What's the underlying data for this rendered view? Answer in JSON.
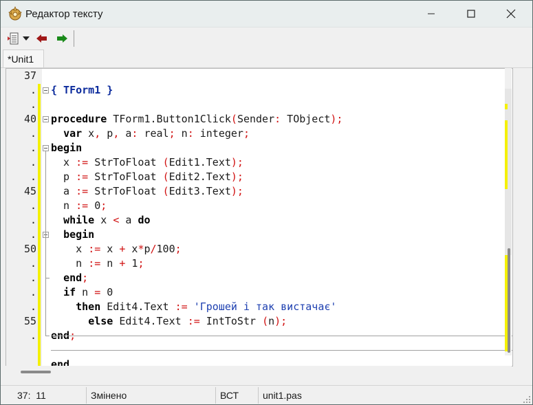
{
  "window": {
    "title": "Редактор тексту",
    "app_icon": "gear-star-icon"
  },
  "toolbar": {
    "items": [
      "document-list-icon",
      "dropdown-arrow-icon",
      "back-arrow-icon",
      "forward-arrow-icon"
    ]
  },
  "tabs": [
    {
      "label": "*Unit1",
      "active": true
    }
  ],
  "editor": {
    "gutter": [
      "37",
      ".",
      ".",
      "40",
      ".",
      ".",
      ".",
      ".",
      "45",
      ".",
      ".",
      ".",
      "50",
      ".",
      ".",
      ".",
      ".",
      "55",
      ".",
      ""
    ],
    "lines": [
      [],
      [
        [
          "cmt",
          "{ TForm1 }"
        ]
      ],
      [],
      [
        [
          "kw",
          "procedure"
        ],
        [
          "txt",
          " TForm1.Button1Click"
        ],
        [
          "sym",
          "("
        ],
        [
          "txt",
          "Sender"
        ],
        [
          "sym",
          ":"
        ],
        [
          "txt",
          " TObject"
        ],
        [
          "sym",
          ");"
        ]
      ],
      [
        [
          "txt",
          "  "
        ],
        [
          "kw",
          "var"
        ],
        [
          "txt",
          " x"
        ],
        [
          "sym",
          ","
        ],
        [
          "txt",
          " p"
        ],
        [
          "sym",
          ","
        ],
        [
          "txt",
          " a"
        ],
        [
          "sym",
          ":"
        ],
        [
          "txt",
          " real"
        ],
        [
          "sym",
          ";"
        ],
        [
          "txt",
          " n"
        ],
        [
          "sym",
          ":"
        ],
        [
          "txt",
          " integer"
        ],
        [
          "sym",
          ";"
        ]
      ],
      [
        [
          "kw",
          "begin"
        ]
      ],
      [
        [
          "txt",
          "  x "
        ],
        [
          "sym",
          ":="
        ],
        [
          "txt",
          " StrToFloat "
        ],
        [
          "sym",
          "("
        ],
        [
          "txt",
          "Edit1.Text"
        ],
        [
          "sym",
          ");"
        ]
      ],
      [
        [
          "txt",
          "  p "
        ],
        [
          "sym",
          ":="
        ],
        [
          "txt",
          " StrToFloat "
        ],
        [
          "sym",
          "("
        ],
        [
          "txt",
          "Edit2.Text"
        ],
        [
          "sym",
          ");"
        ]
      ],
      [
        [
          "txt",
          "  a "
        ],
        [
          "sym",
          ":="
        ],
        [
          "txt",
          " StrToFloat "
        ],
        [
          "sym",
          "("
        ],
        [
          "txt",
          "Edit3.Text"
        ],
        [
          "sym",
          ");"
        ]
      ],
      [
        [
          "txt",
          "  n "
        ],
        [
          "sym",
          ":="
        ],
        [
          "txt",
          " 0"
        ],
        [
          "sym",
          ";"
        ]
      ],
      [
        [
          "txt",
          "  "
        ],
        [
          "kw",
          "while"
        ],
        [
          "txt",
          " x "
        ],
        [
          "sym",
          "<"
        ],
        [
          "txt",
          " a "
        ],
        [
          "kw",
          "do"
        ]
      ],
      [
        [
          "txt",
          "  "
        ],
        [
          "kw",
          "begin"
        ]
      ],
      [
        [
          "txt",
          "    x "
        ],
        [
          "sym",
          ":="
        ],
        [
          "txt",
          " x "
        ],
        [
          "sym",
          "+"
        ],
        [
          "txt",
          " x"
        ],
        [
          "sym",
          "*"
        ],
        [
          "txt",
          "p"
        ],
        [
          "sym",
          "/"
        ],
        [
          "txt",
          "100"
        ],
        [
          "sym",
          ";"
        ]
      ],
      [
        [
          "txt",
          "    n "
        ],
        [
          "sym",
          ":="
        ],
        [
          "txt",
          " n "
        ],
        [
          "sym",
          "+"
        ],
        [
          "txt",
          " 1"
        ],
        [
          "sym",
          ";"
        ]
      ],
      [
        [
          "txt",
          "  "
        ],
        [
          "kw",
          "end"
        ],
        [
          "sym",
          ";"
        ]
      ],
      [
        [
          "txt",
          "  "
        ],
        [
          "kw",
          "if"
        ],
        [
          "txt",
          " n "
        ],
        [
          "sym",
          "="
        ],
        [
          "txt",
          " 0"
        ]
      ],
      [
        [
          "txt",
          "    "
        ],
        [
          "kw",
          "then"
        ],
        [
          "txt",
          " Edit4.Text "
        ],
        [
          "sym",
          ":="
        ],
        [
          "txt",
          " "
        ],
        [
          "str",
          "'Грошей і так вистачає'"
        ]
      ],
      [
        [
          "txt",
          "      "
        ],
        [
          "kw",
          "else"
        ],
        [
          "txt",
          " Edit4.Text "
        ],
        [
          "sym",
          ":="
        ],
        [
          "txt",
          " IntToStr "
        ],
        [
          "sym",
          "("
        ],
        [
          "txt",
          "n"
        ],
        [
          "sym",
          ");"
        ]
      ],
      [
        [
          "kw",
          "end"
        ],
        [
          "sym",
          ";"
        ]
      ],
      [],
      [
        [
          "kw",
          "end"
        ]
      ]
    ]
  },
  "statusbar": {
    "position": "37:  11",
    "state": "Змінено",
    "mode": "ВСТ",
    "filename": "unit1.pas"
  }
}
